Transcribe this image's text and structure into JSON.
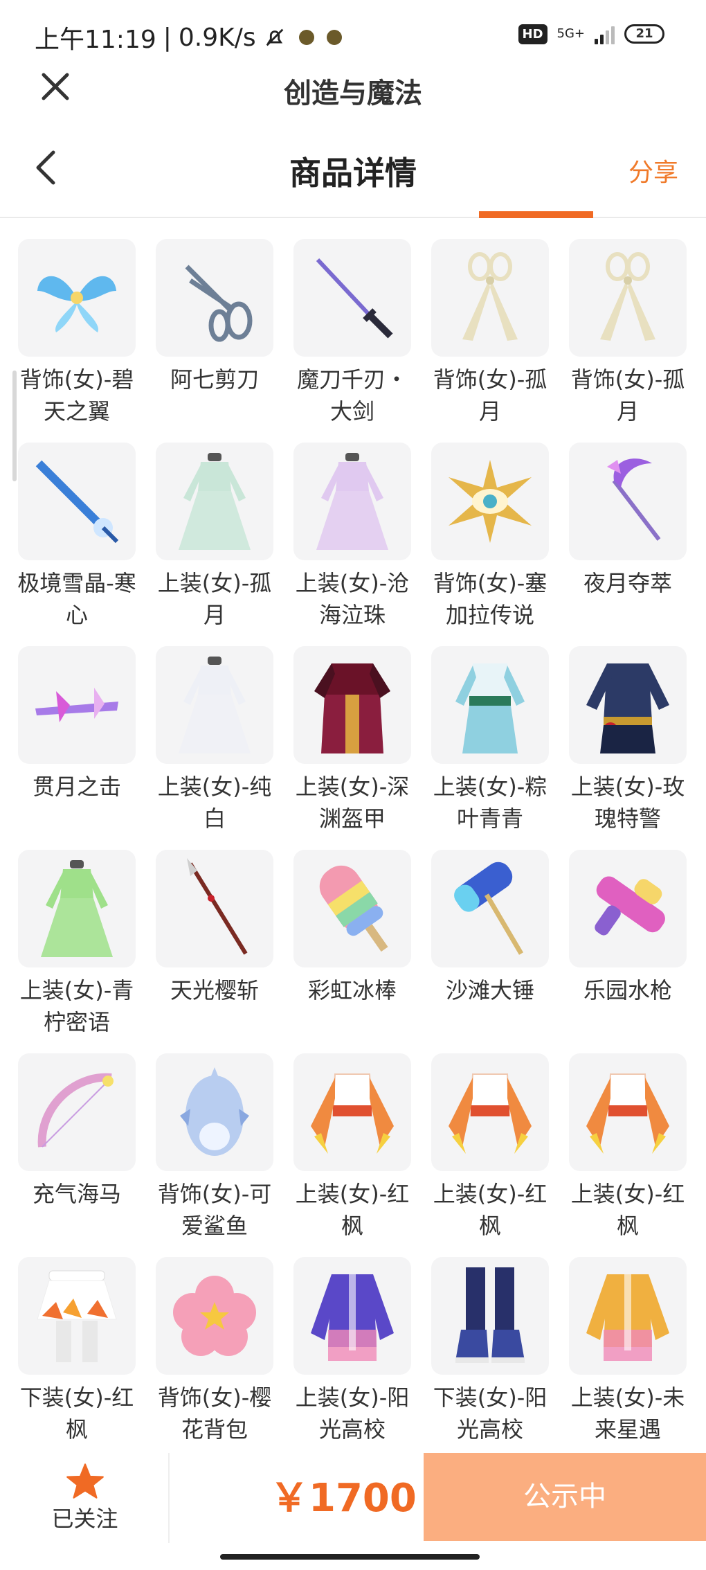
{
  "status_bar": {
    "time": "上午11:19",
    "speed": "0.9K/s",
    "network": "5G+",
    "battery": "21"
  },
  "app_bar": {
    "title": "创造与魔法"
  },
  "nav": {
    "title": "商品详情",
    "share": "分享"
  },
  "items": [
    {
      "name": "背饰(女)-碧天之翼",
      "icon": "blue-wings",
      "color": "#5fb8ee"
    },
    {
      "name": "阿七剪刀",
      "icon": "scissors",
      "color": "#6d7f96"
    },
    {
      "name": "魔刀千刃・大剑",
      "icon": "katana",
      "color": "#2a2a3a"
    },
    {
      "name": "背饰(女)-孤月",
      "icon": "ribbon",
      "color": "#e8e0c0"
    },
    {
      "name": "背饰(女)-孤月",
      "icon": "ribbon",
      "color": "#e8e0c0"
    },
    {
      "name": "极境雪晶-寒心",
      "icon": "ice-sword",
      "color": "#3a7fd8"
    },
    {
      "name": "上装(女)-孤月",
      "icon": "dress",
      "color": "#c9e6d8"
    },
    {
      "name": "上装(女)-沧海泣珠",
      "icon": "dress",
      "color": "#e0c9f0"
    },
    {
      "name": "背饰(女)-塞加拉传说",
      "icon": "golden-eye",
      "color": "#e5b64a"
    },
    {
      "name": "夜月夺萃",
      "icon": "scythe",
      "color": "#9b5fe0"
    },
    {
      "name": "贯月之击",
      "icon": "crossbow",
      "color": "#a77ae8"
    },
    {
      "name": "上装(女)-纯白",
      "icon": "white-dress",
      "color": "#eef0f6"
    },
    {
      "name": "上装(女)-深渊盔甲",
      "icon": "armor",
      "color": "#8a1e3e"
    },
    {
      "name": "上装(女)-粽叶青青",
      "icon": "outfit",
      "color": "#8fd0e0"
    },
    {
      "name": "上装(女)-玫瑰特警",
      "icon": "uniform",
      "color": "#2c3a66"
    },
    {
      "name": "上装(女)-青柠密语",
      "icon": "dress",
      "color": "#9fe08a"
    },
    {
      "name": "天光樱斩",
      "icon": "spear",
      "color": "#7a2a22"
    },
    {
      "name": "彩虹冰棒",
      "icon": "popsicle",
      "color": "#f39ab0"
    },
    {
      "name": "沙滩大锤",
      "icon": "hammer",
      "color": "#3a5fd0"
    },
    {
      "name": "乐园水枪",
      "icon": "water-gun",
      "color": "#e060c0"
    },
    {
      "name": "充气海马",
      "icon": "bow",
      "color": "#e0a0d0"
    },
    {
      "name": "背饰(女)-可爱鲨鱼",
      "icon": "shark",
      "color": "#b8cdf0"
    },
    {
      "name": "上装(女)-红枫",
      "icon": "maple-outfit",
      "color": "#f08a40"
    },
    {
      "name": "上装(女)-红枫",
      "icon": "maple-outfit",
      "color": "#f08a40"
    },
    {
      "name": "上装(女)-红枫",
      "icon": "maple-outfit",
      "color": "#f08a40"
    },
    {
      "name": "下装(女)-红枫",
      "icon": "skirt",
      "color": "#f07030"
    },
    {
      "name": "背饰(女)-樱花背包",
      "icon": "sakura-bag",
      "color": "#f5a0b8"
    },
    {
      "name": "上装(女)-阳光高校",
      "icon": "jacket",
      "color": "#5a48c8"
    },
    {
      "name": "下装(女)-阳光高校",
      "icon": "boots",
      "color": "#28306a"
    },
    {
      "name": "上装(女)-未来星遇",
      "icon": "jacket",
      "color": "#f0b040"
    }
  ],
  "bottom": {
    "follow_label": "已关注",
    "price": "￥1700",
    "status_button": "公示中"
  },
  "colors": {
    "accent": "#f06a24",
    "status_button_bg": "#fbae80"
  }
}
